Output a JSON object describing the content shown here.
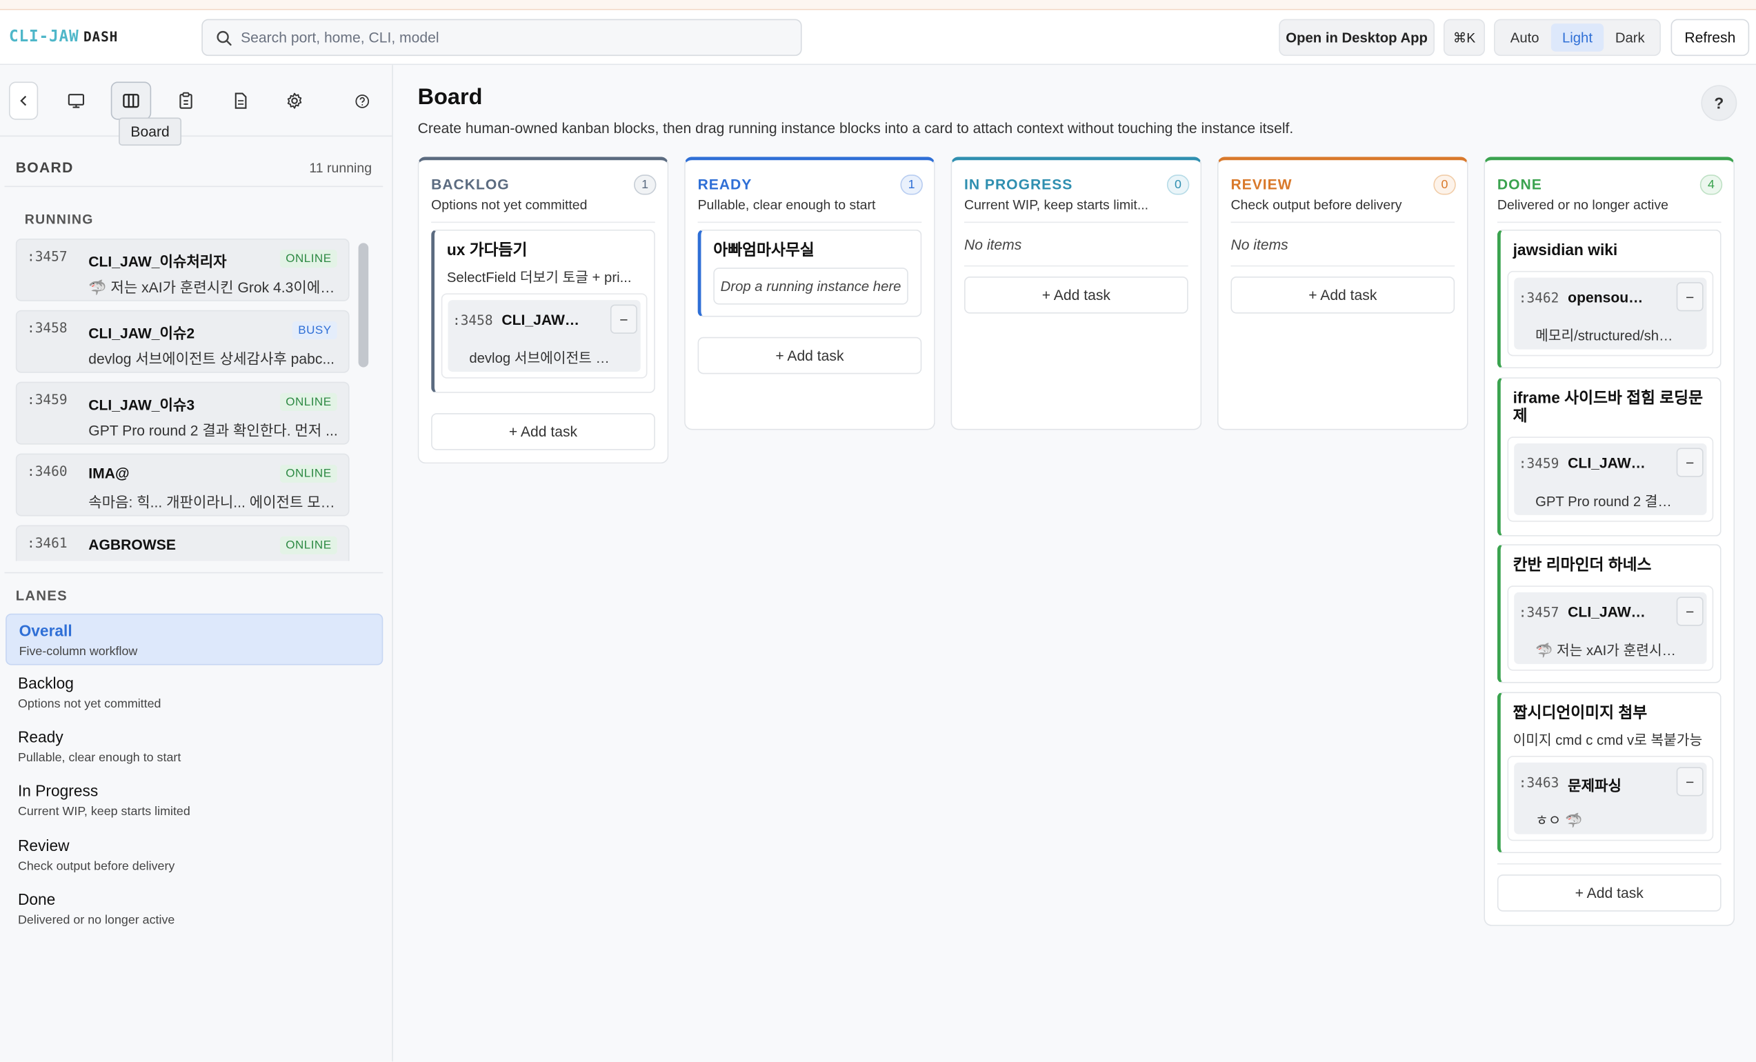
{
  "app": {
    "logo": "CLI-JAW",
    "logo_suffix": "DASH"
  },
  "header": {
    "search_placeholder": "Search port, home, CLI, model",
    "open_desktop": "Open in Desktop App",
    "shortcut": "⌘K",
    "theme_options": [
      "Auto",
      "Light",
      "Dark"
    ],
    "theme_selected": "Light",
    "refresh": "Refresh"
  },
  "sidebar": {
    "icons": [
      "back-icon",
      "monitor-icon",
      "board-icon",
      "clipboard-icon",
      "document-icon",
      "gear-icon",
      "help-circle-icon"
    ],
    "tooltip": "Board",
    "title": "BOARD",
    "count": "11 running",
    "running_heading": "RUNNING",
    "running": [
      {
        "port": ":3457",
        "name": "CLI_JAW_이슈처리자",
        "status": "ONLINE",
        "message": "🦈 저는 xAI가 훈련시킨 Grok 4.3이에요..."
      },
      {
        "port": ":3458",
        "name": "CLI_JAW_이슈2",
        "status": "BUSY",
        "message": "devlog 서브에이전트 상세감사후 pabc..."
      },
      {
        "port": ":3459",
        "name": "CLI_JAW_이슈3",
        "status": "ONLINE",
        "message": "GPT Pro round 2 결과 확인한다. 먼저 ..."
      },
      {
        "port": ":3460",
        "name": "IMA@",
        "status": "ONLINE",
        "message": "속마음: 힉... 개판이라니... 에이전트 모드 ..."
      },
      {
        "port": ":3461",
        "name": "AGBROWSE",
        "status": "ONLINE",
        "message": ""
      }
    ],
    "lanes_heading": "LANES",
    "lanes": [
      {
        "name": "Overall",
        "desc": "Five-column workflow",
        "selected": true
      },
      {
        "name": "Backlog",
        "desc": "Options not yet committed",
        "selected": false
      },
      {
        "name": "Ready",
        "desc": "Pullable, clear enough to start",
        "selected": false
      },
      {
        "name": "In Progress",
        "desc": "Current WIP, keep starts limited",
        "selected": false
      },
      {
        "name": "Review",
        "desc": "Check output before delivery",
        "selected": false
      },
      {
        "name": "Done",
        "desc": "Delivered or no longer active",
        "selected": false
      }
    ]
  },
  "main": {
    "title": "Board",
    "description": "Create human-owned kanban blocks, then drag running instance blocks into a card to attach context without touching the instance itself.",
    "help": "?",
    "add_task": "+ Add task",
    "no_items": "No items",
    "drop_hint": "Drop a running instance here",
    "columns": [
      {
        "key": "backlog",
        "title": "BACKLOG",
        "desc": "Options not yet committed",
        "count": "1",
        "color": "#5b6b80",
        "cards": [
          {
            "title": "ux 가다듬기",
            "subtitle": "SelectField 더보기 토글 + pri...",
            "instance": {
              "port": ":3458",
              "name": "CLI_JAW_...",
              "remove": "−",
              "message": "devlog 서브에이전트 상..."
            }
          }
        ]
      },
      {
        "key": "ready",
        "title": "READY",
        "desc": "Pullable, clear enough to start",
        "count": "1",
        "color": "#2f6fd6",
        "cards": [
          {
            "title": "아빠엄마사무실",
            "subtitle": "",
            "instance": null
          }
        ]
      },
      {
        "key": "in_progress",
        "title": "IN PROGRESS",
        "desc": "Current WIP, keep starts limit...",
        "count": "0",
        "color": "#2f8fb0",
        "cards": []
      },
      {
        "key": "review",
        "title": "REVIEW",
        "desc": "Check output before delivery",
        "count": "0",
        "color": "#d9792b",
        "cards": []
      },
      {
        "key": "done",
        "title": "DONE",
        "desc": "Delivered or no longer active",
        "count": "4",
        "color": "#3ba34f",
        "cards": [
          {
            "title": "jawsidian wiki",
            "subtitle": "",
            "instance": {
              "port": ":3462",
              "name": "opensource",
              "remove": "−",
              "message": "메모리/structured/shar..."
            }
          },
          {
            "title": "iframe 사이드바 접힘 로딩문제",
            "subtitle": "",
            "instance": {
              "port": ":3459",
              "name": "CLI_JAW_...",
              "remove": "−",
              "message": "GPT Pro round 2 결과 ..."
            }
          },
          {
            "title": "칸반 리마인더 하네스",
            "subtitle": "",
            "instance": {
              "port": ":3457",
              "name": "CLI_JAW_...",
              "remove": "−",
              "message": "🦈 저는 xAI가 훈련시킨 ..."
            }
          },
          {
            "title": "짭시디언이미지 첨부",
            "subtitle": "이미지 cmd c cmd v로 복붙가능",
            "instance": {
              "port": ":3463",
              "name": "문제파싱",
              "remove": "−",
              "message": "ㅎㅇ 🦈"
            }
          }
        ]
      }
    ]
  }
}
